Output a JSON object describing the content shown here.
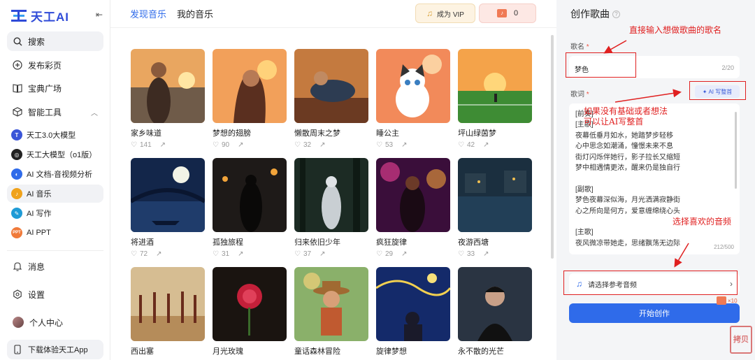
{
  "app": {
    "logo_text": "天工AI"
  },
  "sidebar": {
    "search_label": "搜索",
    "items": [
      {
        "label": "发布彩页",
        "icon": "plus-circle-icon"
      },
      {
        "label": "宝典广场",
        "icon": "book-icon"
      },
      {
        "label": "智能工具",
        "icon": "cube-icon"
      }
    ],
    "tools": [
      {
        "label": "天工3.0大模型",
        "icon": "model-icon",
        "color": "#3b55d8"
      },
      {
        "label": "天工大模型（o1版）",
        "icon": "model-o1-icon",
        "color": "#222222"
      },
      {
        "label": "AI 文档-音视频分析",
        "icon": "analysis-icon",
        "color": "#2f6bea"
      },
      {
        "label": "AI 音乐",
        "icon": "music-icon",
        "color": "#f0a21a"
      },
      {
        "label": "AI 写作",
        "icon": "writing-icon",
        "color": "#1f9bd6"
      },
      {
        "label": "AI PPT",
        "icon": "ppt-icon",
        "color": "#f07a3a"
      }
    ],
    "bottom": [
      {
        "label": "消息",
        "icon": "bell-icon"
      },
      {
        "label": "设置",
        "icon": "gear-icon"
      },
      {
        "label": "个人中心",
        "icon": "avatar"
      }
    ],
    "download_label": "下载体验天工App"
  },
  "main": {
    "tabs": [
      "发现音乐",
      "我的音乐"
    ],
    "vip_label": "成为 VIP",
    "points": "0",
    "cards": [
      {
        "title": "家乡味道",
        "likes": "141",
        "scene": "portrait-sunset"
      },
      {
        "title": "梦想的翅膀",
        "likes": "90",
        "scene": "girl-sunset"
      },
      {
        "title": "懒散周末之梦",
        "likes": "32",
        "scene": "sofa-man"
      },
      {
        "title": "睡公主",
        "likes": "53",
        "scene": "cat"
      },
      {
        "title": "坪山绿茵梦",
        "likes": "42",
        "scene": "football-field"
      },
      {
        "title": "将进酒",
        "likes": "72",
        "scene": "moon-river"
      },
      {
        "title": "孤独旅程",
        "likes": "31",
        "scene": "night-street"
      },
      {
        "title": "归来依旧少年",
        "likes": "37",
        "scene": "forest-figure"
      },
      {
        "title": "疯狂旋律",
        "likes": "29",
        "scene": "concert"
      },
      {
        "title": "夜游西塘",
        "likes": "33",
        "scene": "water-town"
      },
      {
        "title": "西出塞",
        "likes": "",
        "scene": "ancient-army"
      },
      {
        "title": "月光玫瑰",
        "likes": "",
        "scene": "rose"
      },
      {
        "title": "童话森林冒险",
        "likes": "",
        "scene": "boy-hat"
      },
      {
        "title": "旋律梦想",
        "likes": "",
        "scene": "starry-night"
      },
      {
        "title": "永不散的光芒",
        "likes": "",
        "scene": "dark-portrait"
      }
    ]
  },
  "panel": {
    "title": "创作歌曲",
    "name_label": "歌名",
    "name_value": "梦色",
    "name_count": "2/20",
    "lyrics_label": "歌词",
    "ai_button": "AI 写整首",
    "lyrics": "[前奏]\n[主歌]\n夜幕低垂月如水，她踏梦步轻移\n心中思念如潮涌，憧憬未来不息\n街灯闪烁伴她行，影子拉长又缩短\n梦中相遇情更浓，醒来仍是独自行\n\n[副歌]\n梦色夜幕深似海，月光洒满寂静街\n心之所向是何方，爱意缠绵绕心头\n\n[主歌]\n夜风微凉带她走，思绪飘荡无边际",
    "lyrics_count": "212/500",
    "audio_placeholder": "请选择参考音频",
    "start_label": "开始创作",
    "cost": "×10",
    "watermark": "拷贝"
  },
  "annotations": {
    "name_hint": "直接输入想做歌曲的歌名",
    "ai_hint": "如果没有基础或者想法\n可以让AI写整首",
    "audio_hint": "选择喜欢的音频",
    "color": "#e02020"
  }
}
